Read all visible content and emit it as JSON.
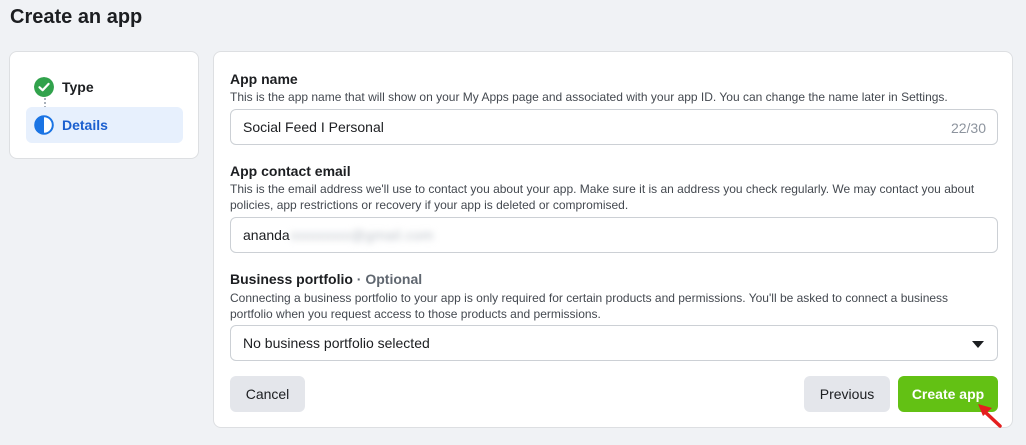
{
  "page": {
    "title": "Create an app"
  },
  "steps": [
    {
      "label": "Type",
      "state": "complete",
      "icon": "check-circle-icon"
    },
    {
      "label": "Details",
      "state": "current",
      "icon": "half-circle-icon"
    }
  ],
  "form": {
    "app_name": {
      "label": "App name",
      "help": "This is the app name that will show on your My Apps page and associated with your app ID. You can change the name later in Settings.",
      "value": "Social Feed I Personal",
      "counter": "22/30"
    },
    "contact_email": {
      "label": "App contact email",
      "help": "This is the email address we'll use to contact you about your app. Make sure it is an address you check regularly. We may contact you about policies, app restrictions or recovery if your app is deleted or compromised.",
      "value": "ananda",
      "redacted_part": "xxxxxxxx@gmail.com"
    },
    "business_portfolio": {
      "label": "Business portfolio",
      "optional": "· Optional",
      "help": "Connecting a business portfolio to your app is only required for certain products and permissions. You'll be asked to connect a business portfolio when you request access to those products and permissions.",
      "selected": "No business portfolio selected"
    }
  },
  "buttons": {
    "cancel": "Cancel",
    "previous": "Previous",
    "create": "Create app"
  },
  "colors": {
    "primary_green": "#63c114",
    "step_active_bg": "#e7f0fd",
    "step_active_text": "#1b5fcf",
    "check_green": "#31a24c",
    "annotation_red": "#e41e1e"
  }
}
